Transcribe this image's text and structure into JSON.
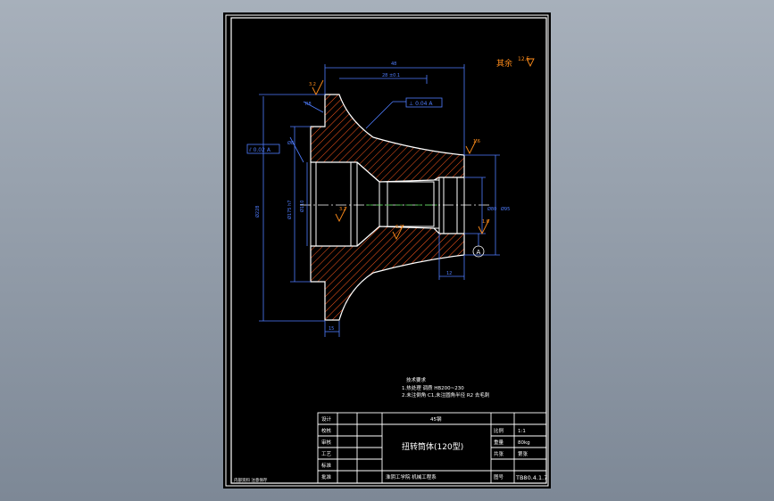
{
  "drawing": {
    "roughness_label": "其余",
    "roughness_value": "12.5",
    "roughness_values": [
      "3.2",
      "1.6",
      "3.2",
      "6.3",
      "1.6"
    ],
    "datum_label": "A",
    "tolerance_1": "⊥ 0.04 A",
    "tolerance_2": "⫽ 0.02 A",
    "tech_req_title": "技术要求",
    "tech_req_1": "1.热处理 调质 HB200~230",
    "tech_req_2": "2.未注倒角 C1,未注圆角半径 R2 去毛刺",
    "colors": {
      "outline": "#ffffff",
      "dimension": "#4f7dff",
      "hatch": "#ff5a1e",
      "roughness": "#ff8c1a",
      "centerline": "#ffffff"
    }
  },
  "title_block": {
    "labels": [
      "设计",
      "校核",
      "审核",
      "工艺",
      "标准",
      "批准"
    ],
    "material": "45钢",
    "scale_label": "比例",
    "scale_value": "1:1",
    "weight_label": "重量",
    "weight_value": "80kg",
    "sheet_label": "共张",
    "sheet_value": "第张",
    "part_name": "扭转筒体(120型)",
    "company": "淮阴工学院 机械工程系",
    "drawing_no_label": "图号",
    "drawing_no": "TB80.4.1.7",
    "footer_note": "内部资料 注意保存"
  }
}
